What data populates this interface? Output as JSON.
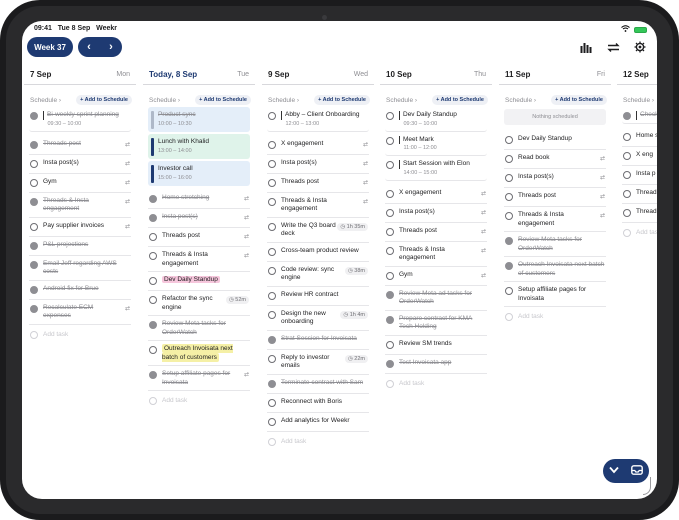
{
  "status": {
    "time": "09:41",
    "date": "Tue 8 Sep",
    "app": "Weekr"
  },
  "toolbar": {
    "week_label": "Week 37",
    "prev": "‹",
    "next": "›"
  },
  "schedule_label": "Schedule",
  "add_schedule_label": "+ Add to Schedule",
  "add_task_label": "Add task",
  "colors": {
    "brand": "#1e3a72",
    "pink": "#f6c6dc",
    "yellow": "#f5f0a6",
    "green_block": "#dff3ea",
    "blue_block": "#e4eef9"
  },
  "columns": [
    {
      "date": "7 Sep",
      "dow": "Mon",
      "schedule": [
        {
          "title": "Bi-weekly sprint planning",
          "time": "09:30 – 10:00",
          "done": true
        }
      ],
      "tasks": [
        {
          "text": "Threads post",
          "done": true,
          "repeat": true
        },
        {
          "text": "Insta post(s)",
          "done": false,
          "repeat": true
        },
        {
          "text": "Gym",
          "done": false,
          "repeat": true
        },
        {
          "text": "Threads & Insta engagement",
          "done": true,
          "repeat": true
        },
        {
          "text": "Pay supplier invoices",
          "done": false,
          "repeat": true
        },
        {
          "text": "P&L projections",
          "done": true
        },
        {
          "text": "Email Jeff regarding AWS costs",
          "done": true
        },
        {
          "text": "Android fix for Brue",
          "done": true
        },
        {
          "text": "Recalculate ECM expenses",
          "done": true,
          "repeat": true
        }
      ]
    },
    {
      "date": "Today, 8 Sep",
      "dow": "Tue",
      "schedule": [
        {
          "title": "Product sync",
          "time": "10:00 – 10:30",
          "done": true
        },
        {
          "title": "Lunch with Khalid",
          "time": "13:00 – 14:00",
          "done": false
        },
        {
          "title": "Investor call",
          "time": "15:00 – 16:00",
          "done": false
        }
      ],
      "tasks": [
        {
          "text": "Home stretching",
          "done": true,
          "repeat": true
        },
        {
          "text": "Insta post(s)",
          "done": true,
          "repeat": true
        },
        {
          "text": "Threads post",
          "done": false,
          "repeat": true
        },
        {
          "text": "Threads & Insta engagement",
          "done": false,
          "repeat": true
        },
        {
          "text": "Dev Daily Standup",
          "done": false,
          "highlight": "pink"
        },
        {
          "text": "Refactor the sync engine",
          "done": false,
          "badge": "52m"
        },
        {
          "text": "Review Meta tasks for OrderWatch",
          "done": true
        },
        {
          "text": "Outreach Invoisata next batch of customers",
          "done": false,
          "highlight": "yellow"
        },
        {
          "text": "Setup affiliate pages for Invoisata",
          "done": true,
          "repeat": true
        }
      ]
    },
    {
      "date": "9 Sep",
      "dow": "Wed",
      "schedule": [
        {
          "title": "Abby – Client Onboarding",
          "time": "12:00 – 13:00",
          "done": false
        }
      ],
      "tasks": [
        {
          "text": "X engagement",
          "done": false,
          "repeat": true
        },
        {
          "text": "Insta post(s)",
          "done": false,
          "repeat": true
        },
        {
          "text": "Threads post",
          "done": false,
          "repeat": true
        },
        {
          "text": "Threads & Insta engagement",
          "done": false,
          "repeat": true
        },
        {
          "text": "Write the Q3 board deck",
          "done": false,
          "badge": "1h 35m"
        },
        {
          "text": "Cross-team product review",
          "done": false
        },
        {
          "text": "Code review: sync engine",
          "done": false,
          "badge": "38m"
        },
        {
          "text": "Review HR contract",
          "done": false
        },
        {
          "text": "Design the new onboarding",
          "done": false,
          "badge": "1h 4m"
        },
        {
          "text": "Strat Session for Invoisata",
          "done": true
        },
        {
          "text": "Reply to investor emails",
          "done": false,
          "badge": "22m"
        },
        {
          "text": "Terminate contract with Sam",
          "done": true
        },
        {
          "text": "Reconnect with Boris",
          "done": false
        },
        {
          "text": "Add analytics for Weekr",
          "done": false
        }
      ]
    },
    {
      "date": "10 Sep",
      "dow": "Thu",
      "schedule": [
        {
          "title": "Dev Daily Standup",
          "time": "09:30 – 10:00",
          "done": false
        },
        {
          "title": "Meet Mark",
          "time": "11:00 – 12:00",
          "done": false
        },
        {
          "title": "Start Session with Elon",
          "time": "14:00 – 15:00",
          "done": false
        }
      ],
      "tasks": [
        {
          "text": "X engagement",
          "done": false,
          "repeat": true
        },
        {
          "text": "Insta post(s)",
          "done": false,
          "repeat": true
        },
        {
          "text": "Threads post",
          "done": false,
          "repeat": true
        },
        {
          "text": "Threads & Insta engagement",
          "done": false,
          "repeat": true
        },
        {
          "text": "Gym",
          "done": false,
          "repeat": true
        },
        {
          "text": "Review Meta ad tasks for OrderWatch",
          "done": true
        },
        {
          "text": "Prepare contract for KMA Tech Holding",
          "done": true
        },
        {
          "text": "Review SM trends",
          "done": false
        },
        {
          "text": "Test Invoisata app",
          "done": true
        }
      ]
    },
    {
      "date": "11 Sep",
      "dow": "Fri",
      "nothing_scheduled": "Nothing scheduled",
      "schedule": [],
      "tasks": [
        {
          "text": "Dev Daily Standup",
          "done": false
        },
        {
          "text": "Read book",
          "done": false,
          "repeat": true
        },
        {
          "text": "Insta post(s)",
          "done": false,
          "repeat": true
        },
        {
          "text": "Threads post",
          "done": false,
          "repeat": true
        },
        {
          "text": "Threads & Insta engagement",
          "done": false,
          "repeat": true
        },
        {
          "text": "Review Meta tasks for OrderWatch",
          "done": true
        },
        {
          "text": "Outreach Invoisata next batch of customers",
          "done": true
        },
        {
          "text": "Setup affiliate pages for Invoisata",
          "done": false
        }
      ]
    },
    {
      "date": "12 Sep",
      "dow": "",
      "schedule": [
        {
          "title": "Check",
          "time": "",
          "done": true
        }
      ],
      "tasks": [
        {
          "text": "Home s",
          "done": false
        },
        {
          "text": "X eng",
          "done": false
        },
        {
          "text": "Insta p",
          "done": false
        },
        {
          "text": "Thread",
          "done": false
        },
        {
          "text": "Thread engage",
          "done": false
        }
      ]
    }
  ]
}
